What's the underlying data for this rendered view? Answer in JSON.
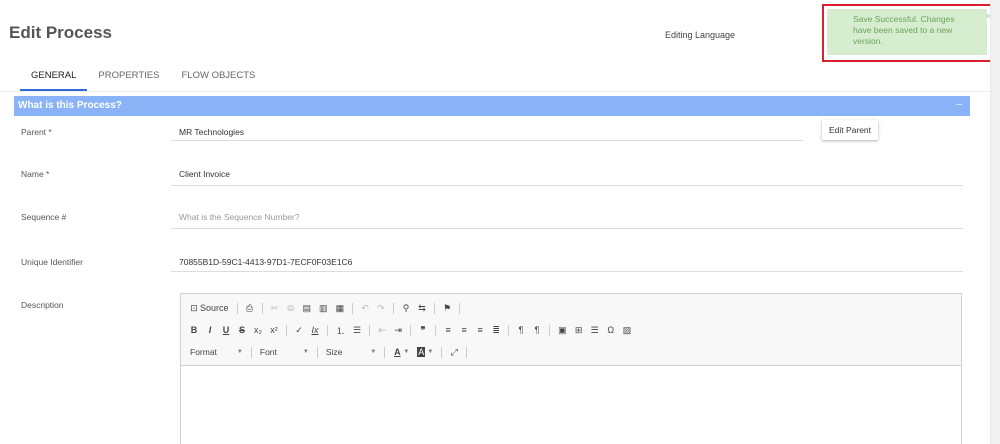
{
  "page": {
    "title": "Edit Process",
    "editing_language_label": "Editing Language"
  },
  "toast": {
    "message": "Save Successful. Changes have been saved to a new version.",
    "close_glyph": "×"
  },
  "tabs": [
    {
      "label": "GENERAL",
      "active": true
    },
    {
      "label": "PROPERTIES",
      "active": false
    },
    {
      "label": "FLOW OBJECTS",
      "active": false
    }
  ],
  "section": {
    "title": "What is this Process?",
    "collapse_glyph": "–"
  },
  "fields": {
    "parent": {
      "label": "Parent  *",
      "value": "MR Technologies",
      "button_label": "Edit Parent"
    },
    "name": {
      "label": "Name *",
      "value": "Client Invoice"
    },
    "sequence": {
      "label": "Sequence #",
      "placeholder": "What is the Sequence Number?"
    },
    "unique_identifier": {
      "label": "Unique Identifier",
      "value": "70855B1D-59C1-4413-97D1-7ECF0F03E1C6"
    },
    "description": {
      "label": "Description"
    }
  },
  "editor": {
    "source_label": "Source",
    "format_label": "Format",
    "font_label": "Font",
    "size_label": "Size",
    "icons_row1": [
      "source-icon",
      "print-icon",
      "cut-icon",
      "copy-icon",
      "paste-icon",
      "paste-text-icon",
      "paste-word-icon",
      "undo-icon",
      "redo-icon",
      "find-icon",
      "replace-icon",
      "anchor-icon"
    ],
    "icons_row2": [
      "bold-icon",
      "italic-icon",
      "underline-icon",
      "strike-icon",
      "subscript-icon",
      "superscript-icon",
      "remove-format-icon",
      "clear-format-icon",
      "numbered-list-icon",
      "bulleted-list-icon",
      "outdent-icon",
      "indent-icon",
      "blockquote-icon",
      "align-left-icon",
      "align-center-icon",
      "align-right-icon",
      "justify-icon",
      "ltr-icon",
      "rtl-icon",
      "flash-icon",
      "table-icon",
      "horizontal-rule-icon",
      "special-char-icon",
      "image-icon"
    ]
  }
}
